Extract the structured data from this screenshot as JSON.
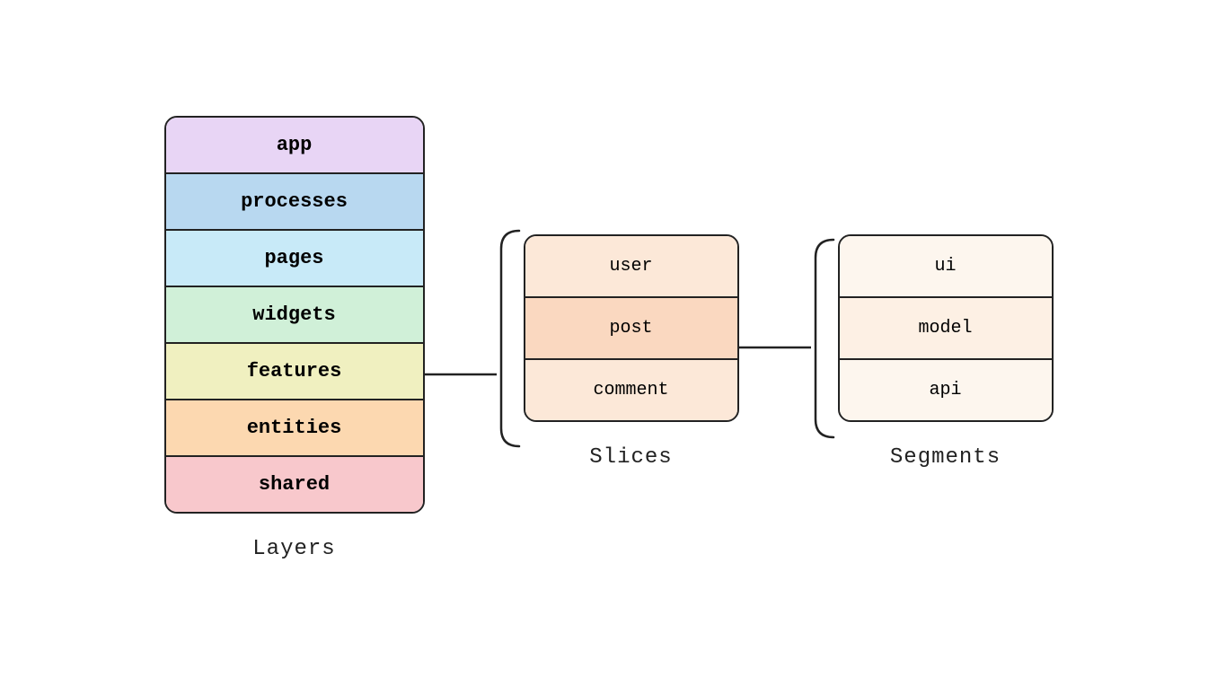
{
  "layers": {
    "title": "Layers",
    "items": [
      {
        "label": "app",
        "class": "layer-app"
      },
      {
        "label": "processes",
        "class": "layer-processes"
      },
      {
        "label": "pages",
        "class": "layer-pages"
      },
      {
        "label": "widgets",
        "class": "layer-widgets"
      },
      {
        "label": "features",
        "class": "layer-features"
      },
      {
        "label": "entities",
        "class": "layer-entities"
      },
      {
        "label": "shared",
        "class": "layer-shared"
      }
    ]
  },
  "slices": {
    "title": "Slices",
    "items": [
      {
        "label": "user",
        "class": "slice-user"
      },
      {
        "label": "post",
        "class": "slice-post"
      },
      {
        "label": "comment",
        "class": "slice-comment"
      }
    ]
  },
  "segments": {
    "title": "Segments",
    "items": [
      {
        "label": "ui",
        "class": "segment-ui"
      },
      {
        "label": "model",
        "class": "segment-model"
      },
      {
        "label": "api",
        "class": "segment-api"
      }
    ]
  }
}
